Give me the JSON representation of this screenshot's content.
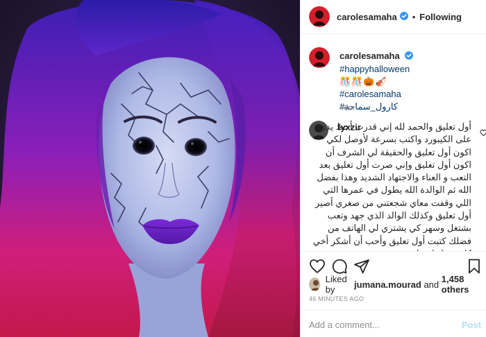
{
  "header": {
    "username": "carolesamaha",
    "separator": "•",
    "follow_label": "Following"
  },
  "caption": {
    "username": "carolesamaha",
    "hashtag1": "#happyhalloween",
    "emojis": "🎊🎊🎃🎻",
    "hashtag2": "#carolesamaha",
    "hashtag3": "#كارول_سماحة",
    "time": "46m"
  },
  "comment": {
    "username": "fyxzir",
    "text": "أول تعليق والحمد لله إني قدرت أحط يدي على الكيبورد واكتب بسرعة لأوصل لكي اكون أول تعليق والحقيقة لي الشرف أن اكون أول تعليق وإني صرت أول تعليق بعد التعب و العناء والاجتهاد الشديد وهذا بفضل الله ثم الوالدة الله يطول في عمرها التي اللي وقفت معاي شجعتني من صغري أصير أول تعليق وكذلك الوالد الذي جهد وتعب بشتغل وسهر كي يشتري لي الهاتف من فضلك كتبت أول تعليق وأحب أن أشكر أخي كان يقول لي يا"
  },
  "likes": {
    "prefix": "Liked by",
    "user": "jumana.mourad",
    "conj": "and",
    "others": "1,458 others"
  },
  "timestamp": "46 MINUTES AGO",
  "add_comment": {
    "placeholder": "Add a comment...",
    "post_label": "Post"
  },
  "colors": {
    "verified": "#3897f0",
    "link": "#00376b",
    "post_disabled": "#b2dffc"
  }
}
